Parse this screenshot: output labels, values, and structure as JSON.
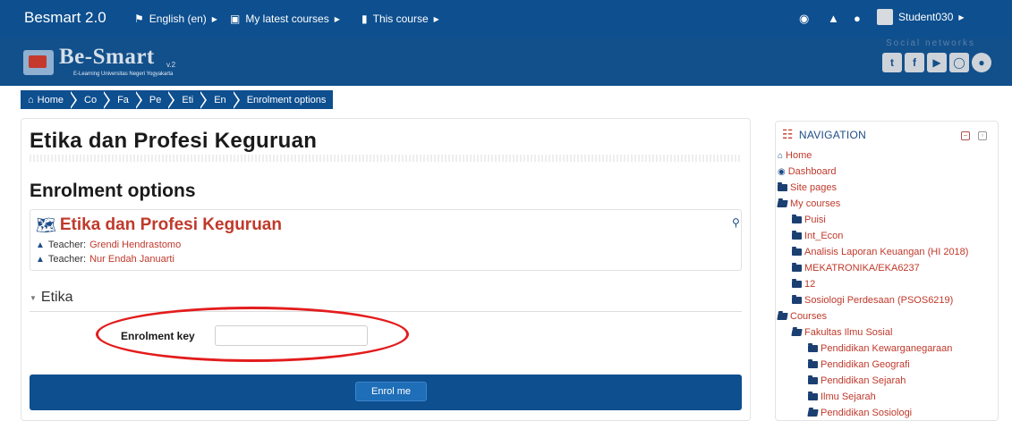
{
  "topbar": {
    "brand": "Besmart 2.0",
    "language": "English (en)",
    "my_courses": "My latest courses",
    "this_course": "This course",
    "username": "Student030"
  },
  "banner": {
    "logo_name": "Be-Smart",
    "logo_version": "v.2",
    "logo_subtitle": "E-Learning Universitas Negeri Yogyakarta",
    "social_title": "Social networks",
    "social_icons": [
      "twitter-icon",
      "facebook-icon",
      "youtube-icon",
      "instagram-icon",
      "globe-icon"
    ]
  },
  "breadcrumb": {
    "items": [
      "Home",
      "Co",
      "Fa",
      "Pe",
      "Eti",
      "En",
      "Enrolment options"
    ]
  },
  "main": {
    "page_title": "Etika dan Profesi Keguruan",
    "sub_title": "Enrolment options",
    "course_name": "Etika dan Profesi Keguruan",
    "teachers": [
      {
        "label": "Teacher:",
        "name": "Grendi Hendrastomo"
      },
      {
        "label": "Teacher:",
        "name": "Nur Endah Januarti"
      }
    ]
  },
  "enrol_section": {
    "heading": "Etika",
    "key_label": "Enrolment key",
    "key_value": "",
    "button": "Enrol me"
  },
  "navigation": {
    "title": "NAVIGATION",
    "items": [
      {
        "label": "Home",
        "icon": "home-icon"
      },
      {
        "label": "Dashboard",
        "icon": "dashboard-icon"
      },
      {
        "label": "Site pages",
        "icon": "folder-icon"
      },
      {
        "label": "My courses",
        "icon": "folder-open-icon"
      },
      {
        "label": "Puisi",
        "icon": "folder-icon"
      },
      {
        "label": "Int_Econ",
        "icon": "folder-icon"
      },
      {
        "label": "Analisis Laporan Keuangan (HI 2018)",
        "icon": "folder-icon"
      },
      {
        "label": "MEKATRONIKA/EKA6237",
        "icon": "folder-icon"
      },
      {
        "label": "12",
        "icon": "folder-icon"
      },
      {
        "label": "Sosiologi Perdesaan (PSOS6219)",
        "icon": "folder-icon"
      },
      {
        "label": "Courses",
        "icon": "folder-open-icon"
      },
      {
        "label": "Fakultas Ilmu Sosial",
        "icon": "folder-open-icon"
      },
      {
        "label": "Pendidikan Kewarganegaraan",
        "icon": "folder-icon"
      },
      {
        "label": "Pendidikan Geografi",
        "icon": "folder-icon"
      },
      {
        "label": "Pendidikan Sejarah",
        "icon": "folder-icon"
      },
      {
        "label": "Ilmu Sejarah",
        "icon": "folder-icon"
      },
      {
        "label": "Pendidikan Sosiologi",
        "icon": "folder-open-icon"
      }
    ]
  },
  "colors": {
    "primary": "#0d4f8f",
    "link": "#c0392b",
    "highlight": "#e31c1c"
  }
}
